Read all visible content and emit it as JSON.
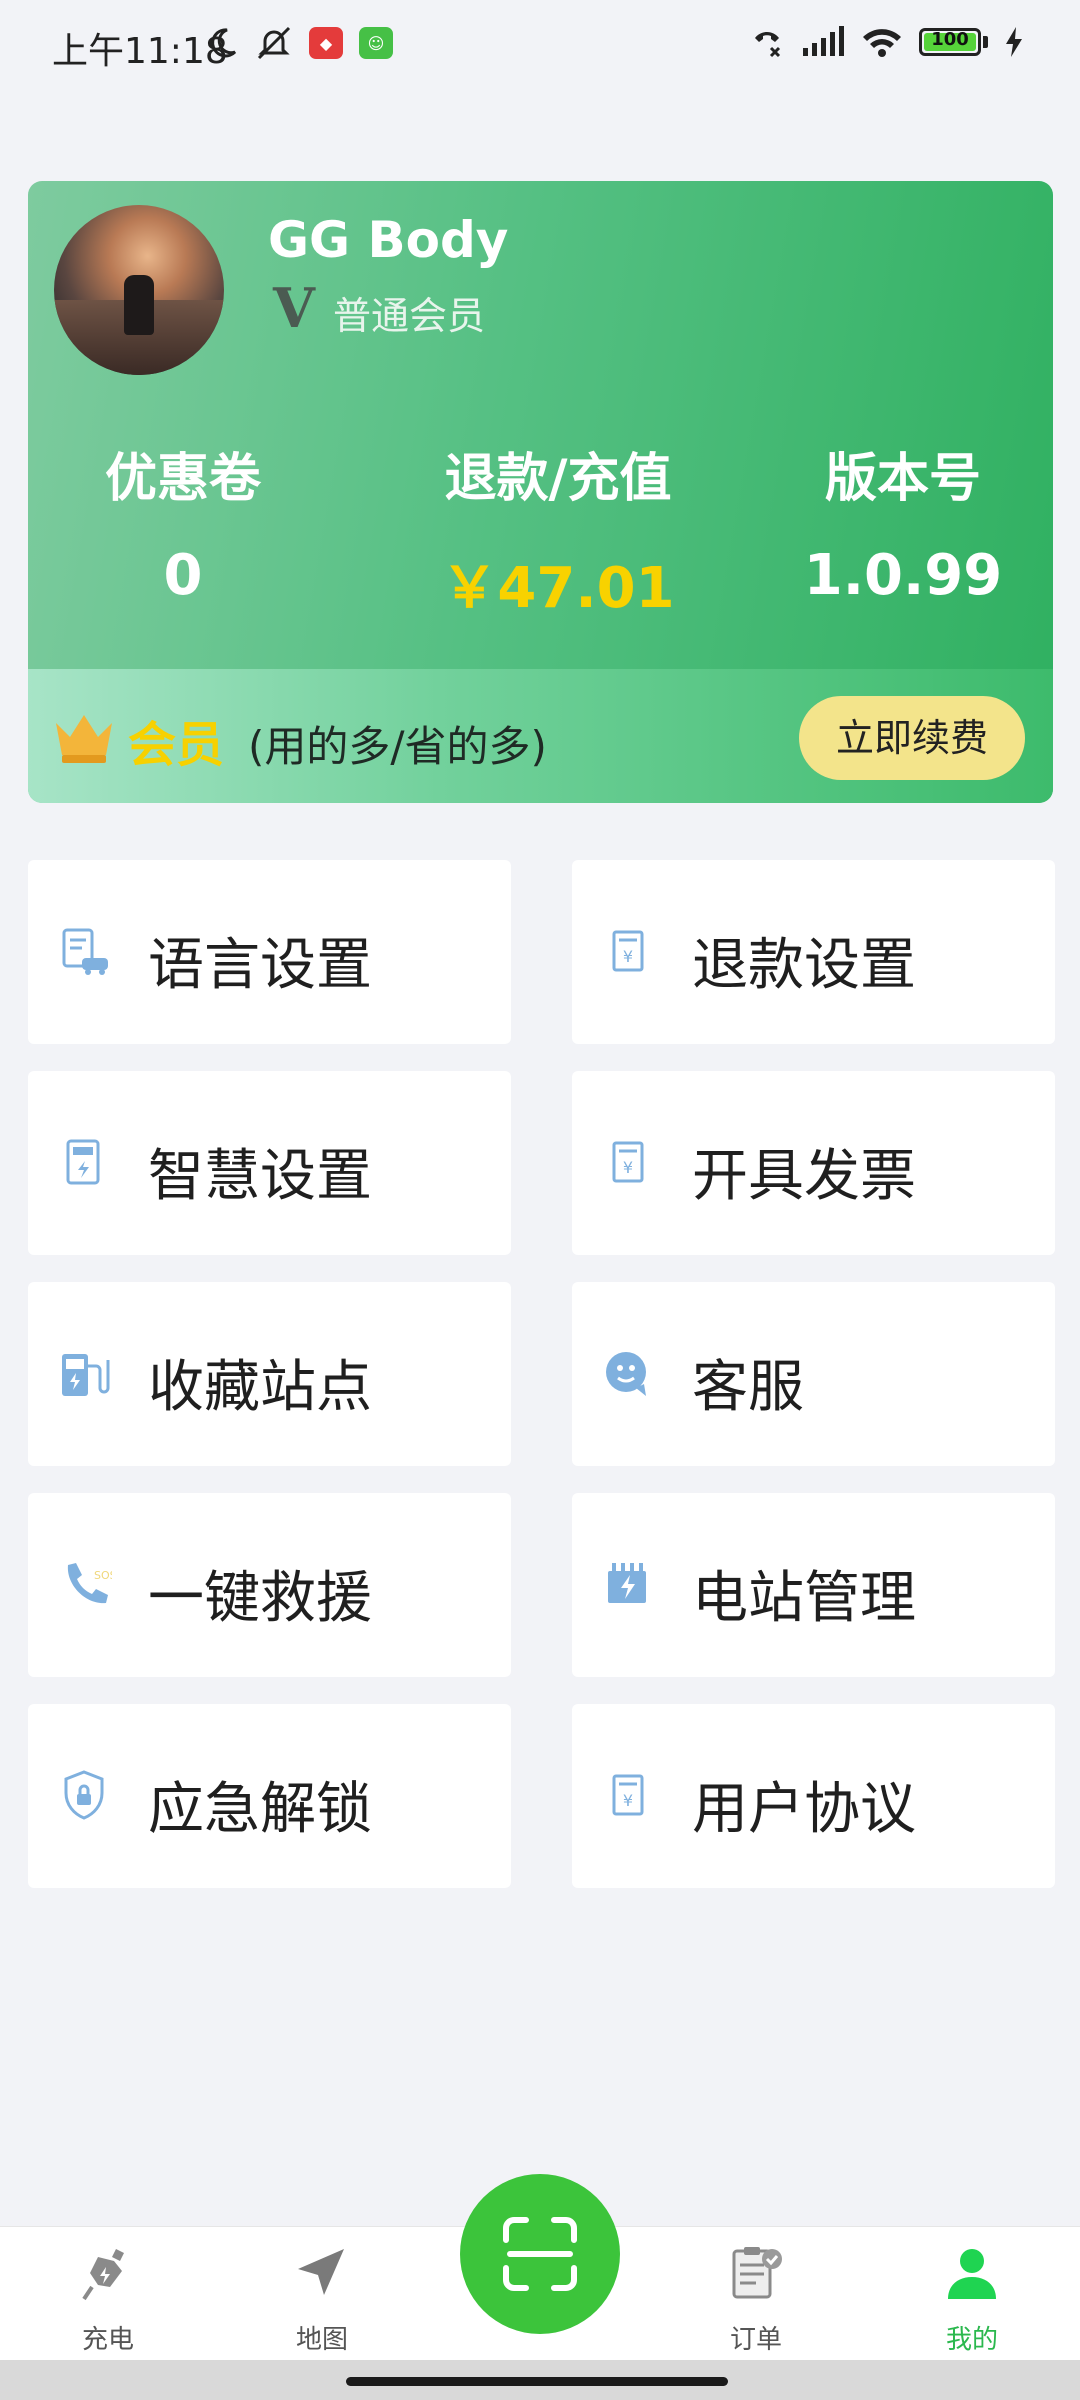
{
  "status_bar": {
    "time": "上午11:18",
    "battery": "100"
  },
  "profile": {
    "name": "GG Body",
    "level_icon": "V",
    "level": "普通会员"
  },
  "stats": [
    {
      "label": "优惠卷",
      "value": "0"
    },
    {
      "label": "退款/充值",
      "value": "￥47.01"
    },
    {
      "label": "版本号",
      "value": "1.0.99"
    }
  ],
  "membership": {
    "title": "会员",
    "subtitle": "(用的多/省的多)",
    "renew_label": "立即续费"
  },
  "menu": [
    {
      "label": "语言设置",
      "icon": "car-document-icon"
    },
    {
      "label": "退款设置",
      "icon": "refund-receipt-icon"
    },
    {
      "label": "智慧设置",
      "icon": "smart-device-icon"
    },
    {
      "label": "开具发票",
      "icon": "invoice-icon"
    },
    {
      "label": "收藏站点",
      "icon": "charging-station-icon"
    },
    {
      "label": "客服",
      "icon": "customer-service-icon"
    },
    {
      "label": "一键救援",
      "icon": "phone-icon"
    },
    {
      "label": "电站管理",
      "icon": "power-station-icon"
    },
    {
      "label": "应急解锁",
      "icon": "shield-lock-icon"
    },
    {
      "label": "用户协议",
      "icon": "agreement-icon"
    }
  ],
  "bottom_nav": [
    {
      "label": "充电",
      "icon": "charge-plug-icon"
    },
    {
      "label": "地图",
      "icon": "navigate-arrow-icon"
    },
    {
      "label": "订单",
      "icon": "order-clipboard-icon"
    },
    {
      "label": "我的",
      "icon": "user-icon",
      "active": true
    }
  ],
  "colors": {
    "accent_green": "#3cc43b",
    "money_yellow": "#f8d200",
    "icon_blue": "#7fb0de"
  }
}
